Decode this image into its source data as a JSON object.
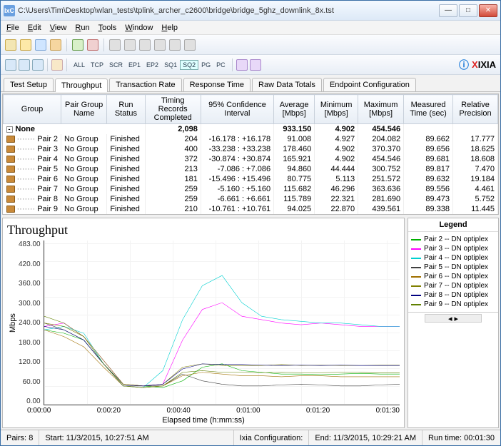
{
  "window": {
    "title": "C:\\Users\\Tim\\Desktop\\wlan_tests\\tplink_archer_c2600\\bridge\\bridge_5ghz_downlink_8x.tst",
    "app_icon_text": "IxC"
  },
  "menu": [
    "File",
    "Edit",
    "View",
    "Run",
    "Tools",
    "Window",
    "Help"
  ],
  "toolbar2": {
    "protocols": [
      "ALL",
      "TCP",
      "SCR",
      "EP1",
      "EP2",
      "SQ1",
      "SQ2",
      "PG",
      "PC"
    ],
    "selected": "SQ2",
    "brand": "IXIA"
  },
  "tabs": [
    "Test Setup",
    "Throughput",
    "Transaction Rate",
    "Response Time",
    "Raw Data Totals",
    "Endpoint Configuration"
  ],
  "active_tab": "Throughput",
  "table": {
    "headers": [
      "Group",
      "Pair Group Name",
      "Run Status",
      "Timing Records Completed",
      "95% Confidence Interval",
      "Average [Mbps]",
      "Minimum [Mbps]",
      "Maximum [Mbps]",
      "Measured Time (sec)",
      "Relative Precision"
    ],
    "total": {
      "label": "None",
      "records": "2,098",
      "avg": "933.150",
      "min": "4.902",
      "max": "454.546"
    },
    "rows": [
      {
        "pair": "Pair 2",
        "grp": "No Group",
        "status": "Finished",
        "rec": "204",
        "ci": "-16.178 : +16.178",
        "avg": "91.008",
        "min": "4.927",
        "max": "204.082",
        "time": "89.662",
        "prec": "17.777"
      },
      {
        "pair": "Pair 3",
        "grp": "No Group",
        "status": "Finished",
        "rec": "400",
        "ci": "-33.238 : +33.238",
        "avg": "178.460",
        "min": "4.902",
        "max": "370.370",
        "time": "89.656",
        "prec": "18.625"
      },
      {
        "pair": "Pair 4",
        "grp": "No Group",
        "status": "Finished",
        "rec": "372",
        "ci": "-30.874 : +30.874",
        "avg": "165.921",
        "min": "4.902",
        "max": "454.546",
        "time": "89.681",
        "prec": "18.608"
      },
      {
        "pair": "Pair 5",
        "grp": "No Group",
        "status": "Finished",
        "rec": "213",
        "ci": "-7.086 : +7.086",
        "avg": "94.860",
        "min": "44.444",
        "max": "300.752",
        "time": "89.817",
        "prec": "7.470"
      },
      {
        "pair": "Pair 6",
        "grp": "No Group",
        "status": "Finished",
        "rec": "181",
        "ci": "-15.496 : +15.496",
        "avg": "80.775",
        "min": "5.113",
        "max": "251.572",
        "time": "89.632",
        "prec": "19.184"
      },
      {
        "pair": "Pair 7",
        "grp": "No Group",
        "status": "Finished",
        "rec": "259",
        "ci": "-5.160 : +5.160",
        "avg": "115.682",
        "min": "46.296",
        "max": "363.636",
        "time": "89.556",
        "prec": "4.461"
      },
      {
        "pair": "Pair 8",
        "grp": "No Group",
        "status": "Finished",
        "rec": "259",
        "ci": "-6.661 : +6.661",
        "avg": "115.789",
        "min": "22.321",
        "max": "281.690",
        "time": "89.473",
        "prec": "5.752"
      },
      {
        "pair": "Pair 9",
        "grp": "No Group",
        "status": "Finished",
        "rec": "210",
        "ci": "-10.761 : +10.761",
        "avg": "94.025",
        "min": "22.870",
        "max": "439.561",
        "time": "89.338",
        "prec": "11.445"
      }
    ]
  },
  "chart": {
    "title": "Throughput",
    "ylabel": "Mbps",
    "xlabel": "Elapsed time (h:mm:ss)",
    "yticks": [
      "483.00",
      "420.00",
      "360.00",
      "300.00",
      "240.00",
      "180.00",
      "120.00",
      "60.00",
      "0.00"
    ],
    "xticks": [
      "0:00:00",
      "0:00:20",
      "0:00:40",
      "0:01:00",
      "0:01:20",
      "0:01:30"
    ],
    "legend_title": "Legend",
    "legend": [
      {
        "label": "Pair 2 -- DN optiplex",
        "color": "#00b000"
      },
      {
        "label": "Pair 3 -- DN optiplex",
        "color": "#ff00ff"
      },
      {
        "label": "Pair 4 -- DN optiplex",
        "color": "#00d0d0"
      },
      {
        "label": "Pair 5 -- DN optiplex",
        "color": "#404040"
      },
      {
        "label": "Pair 6 -- DN optiplex",
        "color": "#a07000"
      },
      {
        "label": "Pair 7 -- DN optiplex",
        "color": "#808000"
      },
      {
        "label": "Pair 8 -- DN optiplex",
        "color": "#000080"
      },
      {
        "label": "Pair 9 -- DN optiplex",
        "color": "#608000"
      }
    ]
  },
  "chart_data": {
    "type": "line",
    "title": "Throughput",
    "xlabel": "Elapsed time (h:mm:ss)",
    "ylabel": "Mbps",
    "ylim": [
      0,
      483
    ],
    "x_seconds": [
      0,
      5,
      10,
      15,
      20,
      25,
      30,
      35,
      40,
      45,
      50,
      55,
      60,
      65,
      70,
      75,
      80,
      85,
      90
    ],
    "series": [
      {
        "name": "Pair 2 -- DN optiplex",
        "color": "#00b000",
        "values": [
          220,
          210,
          190,
          120,
          60,
          55,
          50,
          70,
          110,
          120,
          100,
          95,
          90,
          90,
          88,
          90,
          92,
          90,
          90
        ]
      },
      {
        "name": "Pair 3 -- DN optiplex",
        "color": "#ff00ff",
        "values": [
          230,
          240,
          200,
          130,
          60,
          55,
          60,
          190,
          280,
          300,
          260,
          250,
          240,
          235,
          240,
          235,
          230,
          230,
          230
        ]
      },
      {
        "name": "Pair 4 -- DN optiplex",
        "color": "#00d0d0",
        "values": [
          220,
          230,
          210,
          120,
          55,
          50,
          100,
          250,
          350,
          380,
          300,
          260,
          250,
          245,
          240,
          240,
          235,
          230,
          230
        ]
      },
      {
        "name": "Pair 5 -- DN optiplex",
        "color": "#404040",
        "values": [
          240,
          220,
          190,
          120,
          60,
          55,
          55,
          90,
          70,
          60,
          55,
          55,
          58,
          60,
          58,
          55,
          55,
          58,
          60
        ]
      },
      {
        "name": "Pair 6 -- DN optiplex",
        "color": "#a07000",
        "values": [
          220,
          200,
          170,
          110,
          55,
          50,
          55,
          85,
          95,
          90,
          85,
          85,
          82,
          85,
          85,
          82,
          82,
          82,
          82
        ]
      },
      {
        "name": "Pair 7 -- DN optiplex",
        "color": "#808000",
        "values": [
          240,
          230,
          200,
          130,
          60,
          55,
          60,
          110,
          120,
          115,
          115,
          115,
          118,
          115,
          116,
          115,
          115,
          116,
          116
        ]
      },
      {
        "name": "Pair 8 -- DN optiplex",
        "color": "#000080",
        "values": [
          230,
          220,
          190,
          120,
          55,
          55,
          60,
          105,
          120,
          118,
          118,
          116,
          115,
          116,
          115,
          116,
          115,
          115,
          115
        ]
      },
      {
        "name": "Pair 9 -- DN optiplex",
        "color": "#608000",
        "values": [
          260,
          240,
          200,
          120,
          55,
          50,
          55,
          95,
          100,
          95,
          95,
          94,
          95,
          94,
          94,
          95,
          95,
          93,
          93
        ]
      }
    ]
  },
  "status": {
    "pairs_label": "Pairs:",
    "pairs": "8",
    "start_label": "Start:",
    "start": "11/3/2015, 10:27:51 AM",
    "config_label": "Ixia Configuration:",
    "end_label": "End:",
    "end": "11/3/2015, 10:29:21 AM",
    "runtime_label": "Run time:",
    "runtime": "00:01:30"
  }
}
